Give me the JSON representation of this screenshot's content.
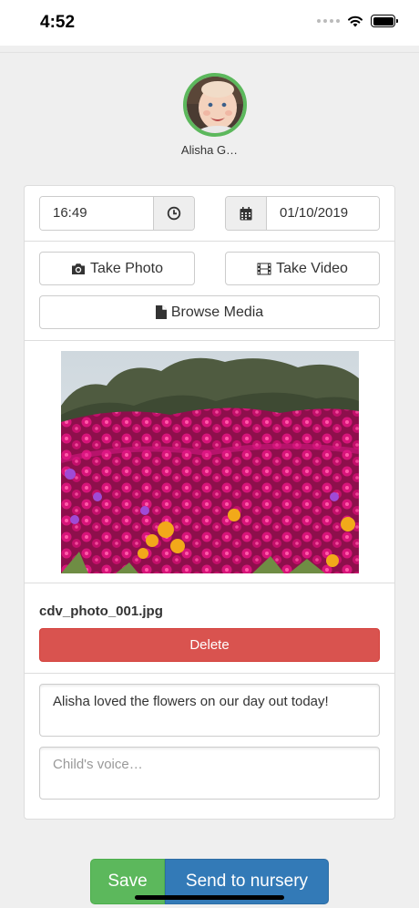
{
  "status_bar": {
    "time": "4:52"
  },
  "child": {
    "name": "Alisha G…"
  },
  "entry": {
    "time": "16:49",
    "date": "01/10/2019"
  },
  "media": {
    "take_photo": "Take Photo",
    "take_video": "Take Video",
    "browse_media": "Browse Media",
    "filename": "cdv_photo_001.jpg",
    "delete": "Delete"
  },
  "notes": {
    "observation": "Alisha loved the flowers on our day out today!",
    "child_voice_placeholder": "Child's voice…"
  },
  "actions": {
    "save": "Save",
    "send": "Send to nursery"
  },
  "colors": {
    "save": "#5cb85c",
    "send": "#337ab7",
    "delete": "#d9534f",
    "avatar_ring": "#5cb85c"
  }
}
